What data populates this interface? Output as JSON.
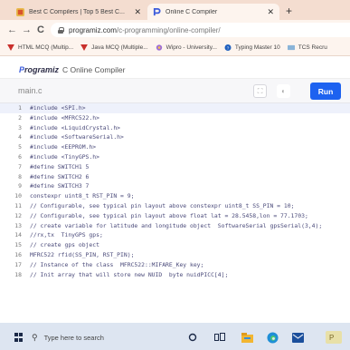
{
  "browser": {
    "tabs": [
      {
        "title": "Best C Compilers | Top 5 Best C...",
        "active": false
      },
      {
        "title": "Online C Compiler",
        "active": true
      }
    ],
    "new_tab": "+",
    "nav": {
      "back": "←",
      "forward": "→",
      "reload": "C"
    },
    "url_host": "programiz.com",
    "url_path": "/c-programming/online-compiler/",
    "bookmarks": [
      {
        "label": "HTML MCQ (Multip..."
      },
      {
        "label": "Java MCQ (Multiple..."
      },
      {
        "label": "Wipro - University..."
      },
      {
        "label": "Typing Master 10"
      },
      {
        "label": "TCS Recru"
      }
    ]
  },
  "app": {
    "brand_p": "P",
    "brand_rest": "rogramiz",
    "title": "C Online Compiler",
    "filename": "main.c",
    "run_label": "Run",
    "fullscreen_glyph": "⛶",
    "theme_glyph": "◐"
  },
  "code_lines": [
    {
      "n": "1",
      "text": "#include <SPI.h>"
    },
    {
      "n": "2",
      "text": "#include <MFRC522.h>"
    },
    {
      "n": "3",
      "text": "#include <LiquidCrystal.h>"
    },
    {
      "n": "4",
      "text": "#include <SoftwareSerial.h>"
    },
    {
      "n": "5",
      "text": "#include <EEPROM.h>"
    },
    {
      "n": "6",
      "text": "#include <TinyGPS.h>"
    },
    {
      "n": "7",
      "text": "#define SWITCH1 5"
    },
    {
      "n": "8",
      "text": "#define SWITCH2 6"
    },
    {
      "n": "9",
      "text": "#define SWITCH3 7"
    },
    {
      "n": "10",
      "text": "constexpr uint8_t RST_PIN = 9;"
    },
    {
      "n": "11",
      "text": "// Configurable, see typical pin layout above constexpr uint8_t SS_PIN = 10;"
    },
    {
      "n": "12",
      "text": "// Configurable, see typical pin layout above float lat = 28.5458,lon = 77.1703;"
    },
    {
      "n": "13",
      "text": "// create variable for latitude and longitude object  SoftwareSerial gpsSerial(3,4);"
    },
    {
      "n": "14",
      "text": "//rx,tx  TinyGPS gps;"
    },
    {
      "n": "15",
      "text": "// create gps object"
    },
    {
      "n": "16",
      "text": "MFRC522 rfid(SS_PIN, RST_PIN);"
    },
    {
      "n": "17",
      "text": "// Instance of the class  MFRC522::MIFARE_Key key;"
    },
    {
      "n": "18",
      "text": "// Init array that will store new NUID  byte nuidPICC[4];"
    }
  ],
  "taskbar": {
    "search_placeholder": "Type here to search",
    "icons": [
      "search-circle-icon",
      "task-view-icon",
      "file-explorer-icon",
      "edge-icon",
      "mail-icon"
    ]
  }
}
